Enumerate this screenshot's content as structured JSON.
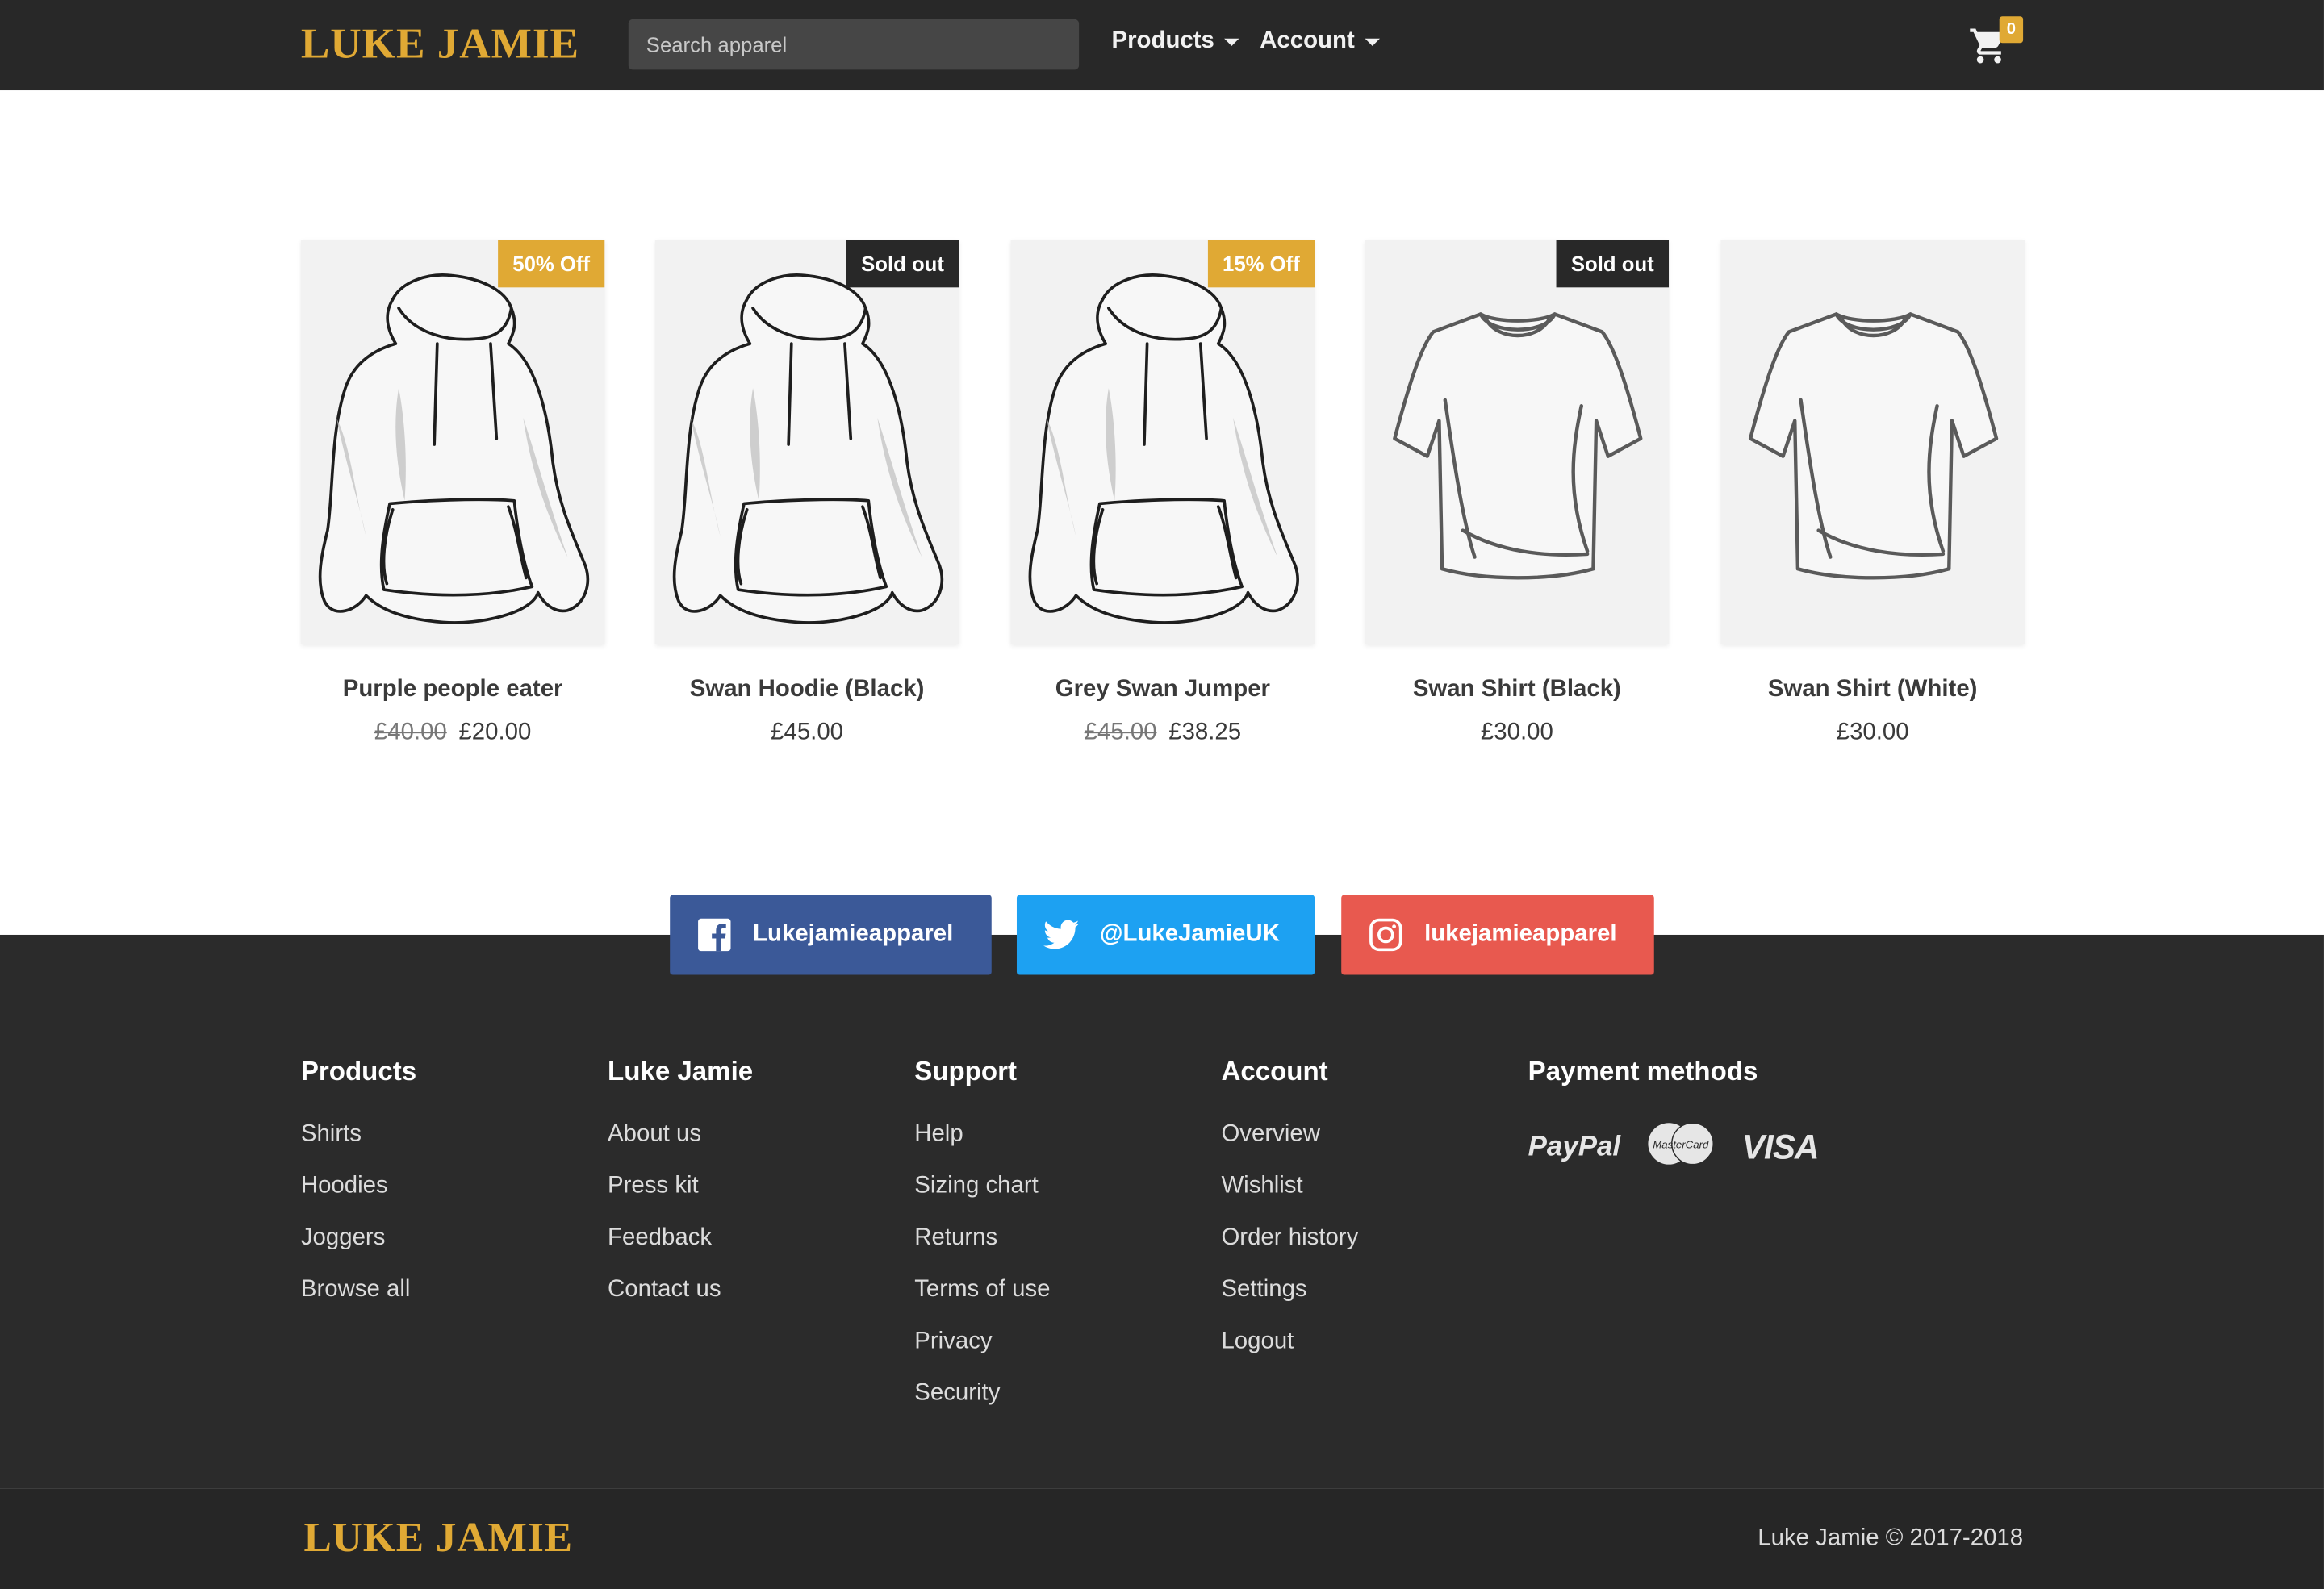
{
  "header": {
    "brand": "LUKE JAMIE",
    "search_placeholder": "Search apparel",
    "nav": [
      {
        "label": "Products"
      },
      {
        "label": "Account"
      }
    ],
    "cart_count": "0"
  },
  "products": [
    {
      "name": "Purple people eater",
      "old_price": "£40.00",
      "price": "£20.00",
      "badge": "50% Off",
      "badge_color": "#e0a934",
      "kind": "hoodie"
    },
    {
      "name": "Swan Hoodie (Black)",
      "old_price": "",
      "price": "£45.00",
      "badge": "Sold out",
      "badge_color": "#282828",
      "kind": "hoodie"
    },
    {
      "name": "Grey Swan Jumper",
      "old_price": "£45.00",
      "price": "£38.25",
      "badge": "15% Off",
      "badge_color": "#e0a934",
      "kind": "hoodie"
    },
    {
      "name": "Swan Shirt (Black)",
      "old_price": "",
      "price": "£30.00",
      "badge": "Sold out",
      "badge_color": "#282828",
      "kind": "shirt"
    },
    {
      "name": "Swan Shirt (White)",
      "old_price": "",
      "price": "£30.00",
      "badge": "",
      "badge_color": "",
      "kind": "shirt"
    }
  ],
  "social": {
    "facebook": {
      "label": "Lukejamieapparel",
      "color": "#3b5998"
    },
    "twitter": {
      "label": "@LukeJamieUK",
      "color": "#1da1f2"
    },
    "instagram": {
      "label": "lukejamieapparel",
      "color": "#e8594f"
    }
  },
  "footer": {
    "columns": [
      {
        "heading": "Products",
        "links": [
          "Shirts",
          "Hoodies",
          "Joggers",
          "Browse all"
        ]
      },
      {
        "heading": "Luke Jamie",
        "links": [
          "About us",
          "Press kit",
          "Feedback",
          "Contact us"
        ]
      },
      {
        "heading": "Support",
        "links": [
          "Help",
          "Sizing chart",
          "Returns",
          "Terms of use",
          "Privacy",
          "Security"
        ]
      },
      {
        "heading": "Account",
        "links": [
          "Overview",
          "Wishlist",
          "Order history",
          "Settings",
          "Logout"
        ]
      }
    ],
    "payment_heading": "Payment methods",
    "payment_methods": {
      "paypal": "PayPal",
      "mastercard": "MasterCard",
      "visa": "VISA"
    },
    "brand": "LUKE JAMIE",
    "copyright": "Luke Jamie © 2017-2018"
  },
  "colors": {
    "accent": "#e0a934",
    "header_bg": "#282828",
    "footer_bg": "#2b2b2b"
  }
}
